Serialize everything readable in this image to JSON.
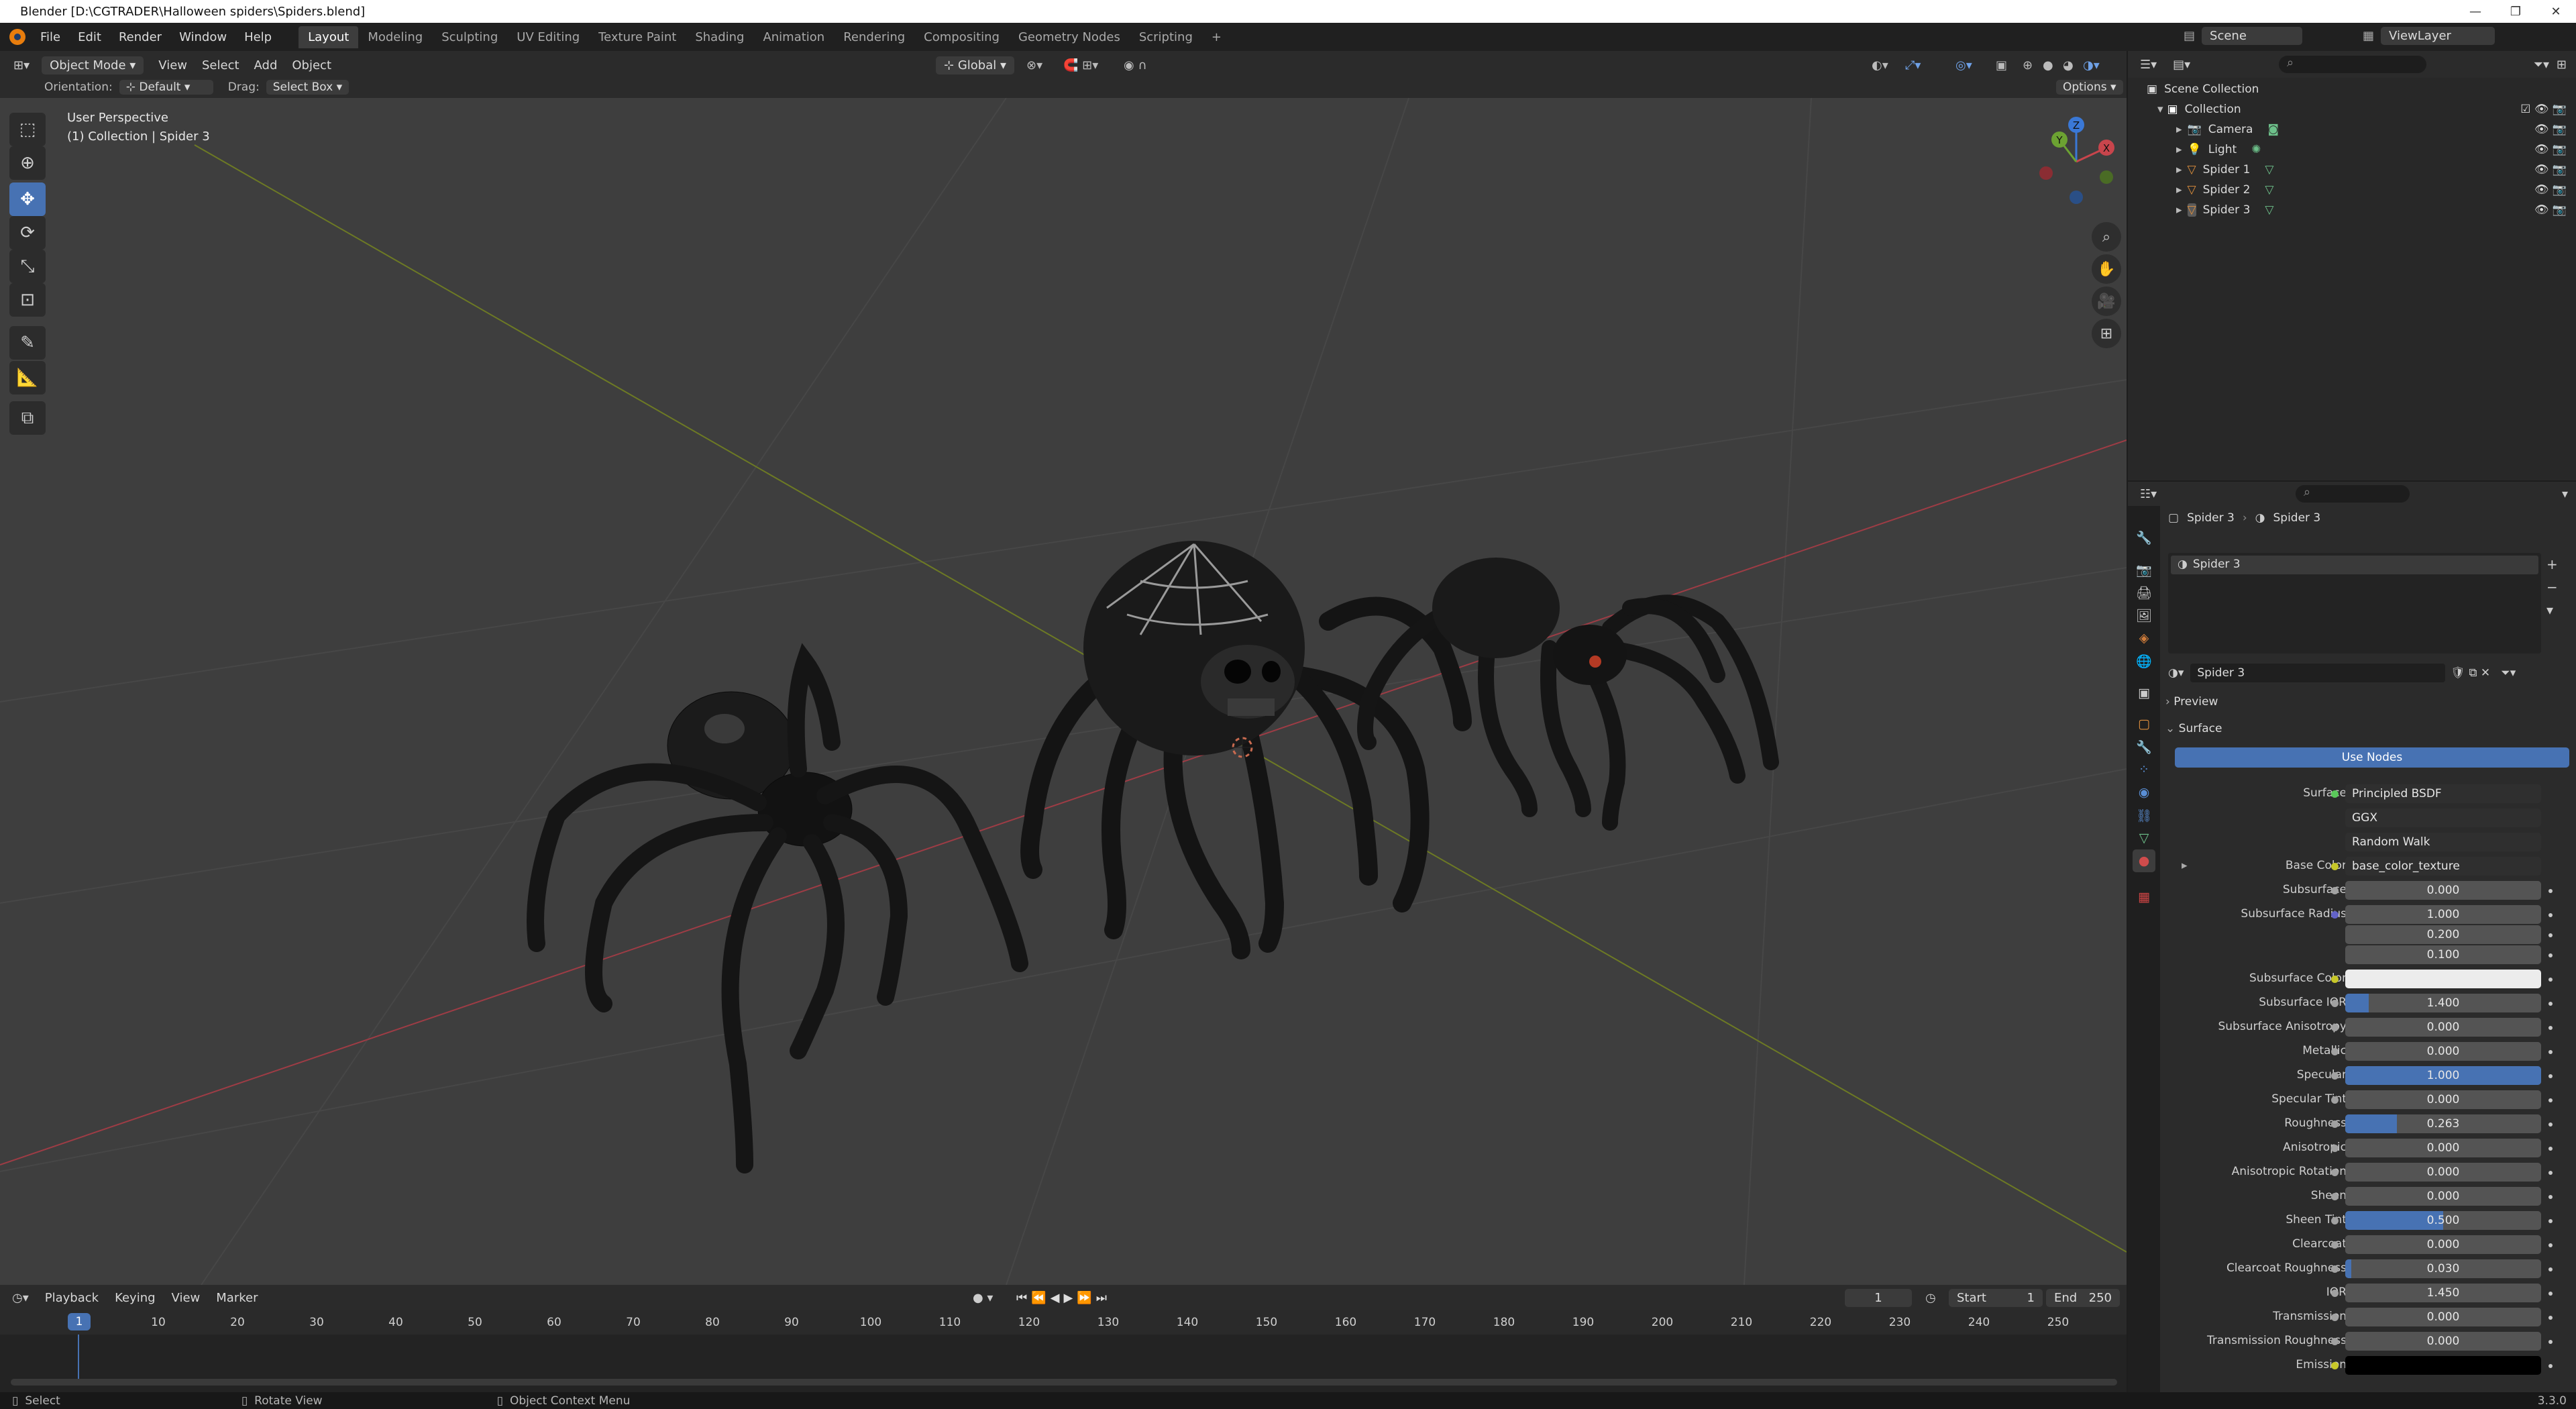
{
  "window": {
    "title": "Blender [D:\\CGTRADER\\Halloween spiders\\Spiders.blend]",
    "min": "—",
    "max": "❐",
    "close": "✕"
  },
  "menus": [
    "File",
    "Edit",
    "Render",
    "Window",
    "Help"
  ],
  "workspaces": [
    "Layout",
    "Modeling",
    "Sculpting",
    "UV Editing",
    "Texture Paint",
    "Shading",
    "Animation",
    "Rendering",
    "Compositing",
    "Geometry Nodes",
    "Scripting",
    "+"
  ],
  "scene": {
    "name": "Scene",
    "view_layer": "ViewLayer"
  },
  "viewport": {
    "mode": "Object Mode",
    "header_menus": [
      "View",
      "Select",
      "Add",
      "Object"
    ],
    "transform_orientation": "Global",
    "orientation_label": "Orientation:",
    "orientation_value": "Default",
    "drag_label": "Drag:",
    "drag_value": "Select Box",
    "options": "Options",
    "overlay_title": "User Perspective",
    "overlay_sub": "(1) Collection | Spider 3",
    "gizmo": {
      "x": "X",
      "y": "Y",
      "z": "Z"
    }
  },
  "outliner": {
    "scene_collection": "Scene Collection",
    "collection": "Collection",
    "items": [
      {
        "name": "Camera"
      },
      {
        "name": "Light"
      },
      {
        "name": "Spider 1"
      },
      {
        "name": "Spider 2"
      },
      {
        "name": "Spider 3"
      }
    ]
  },
  "properties": {
    "breadcrumb_object": "Spider 3",
    "breadcrumb_material": "Spider 3",
    "slot": "Spider 3",
    "material": "Spider 3",
    "preview": "Preview",
    "surface_panel": "Surface",
    "use_nodes": "Use Nodes",
    "surface_label": "Surface",
    "surface_value": "Principled BSDF",
    "distribution": "GGX",
    "subsurface_method": "Random Walk",
    "base_color_label": "Base Color",
    "base_color_value": "base_color_texture",
    "params": [
      {
        "label": "Subsurface",
        "value": "0.000",
        "fraction": 0
      },
      {
        "label": "Subsurface Radius",
        "value": "1.000",
        "fraction": 0
      },
      {
        "label": "",
        "value": "0.200",
        "fraction": 0
      },
      {
        "label": "",
        "value": "0.100",
        "fraction": 0
      },
      {
        "label": "Subsurface Color",
        "value": "",
        "fraction": 0
      },
      {
        "label": "Subsurface IOR",
        "value": "1.400",
        "fraction": 0.12
      },
      {
        "label": "Subsurface Anisotropy",
        "value": "0.000",
        "fraction": 0
      },
      {
        "label": "Metallic",
        "value": "0.000",
        "fraction": 0
      },
      {
        "label": "Specular",
        "value": "1.000",
        "fraction": 1
      },
      {
        "label": "Specular Tint",
        "value": "0.000",
        "fraction": 0
      },
      {
        "label": "Roughness",
        "value": "0.263",
        "fraction": 0.263
      },
      {
        "label": "Anisotropic",
        "value": "0.000",
        "fraction": 0
      },
      {
        "label": "Anisotropic Rotation",
        "value": "0.000",
        "fraction": 0
      },
      {
        "label": "Sheen",
        "value": "0.000",
        "fraction": 0
      },
      {
        "label": "Sheen Tint",
        "value": "0.500",
        "fraction": 0.5
      },
      {
        "label": "Clearcoat",
        "value": "0.000",
        "fraction": 0
      },
      {
        "label": "Clearcoat Roughness",
        "value": "0.030",
        "fraction": 0.03
      },
      {
        "label": "IOR",
        "value": "1.450",
        "fraction": 0
      },
      {
        "label": "Transmission",
        "value": "0.000",
        "fraction": 0
      },
      {
        "label": "Transmission Roughness",
        "value": "0.000",
        "fraction": 0
      },
      {
        "label": "Emission",
        "value": "",
        "fraction": 0
      }
    ]
  },
  "timeline": {
    "menus": [
      "Playback",
      "Keying",
      "View",
      "Marker"
    ],
    "current_frame": "1",
    "start_label": "Start",
    "start": "1",
    "end_label": "End",
    "end": "250",
    "ticks": [
      "10",
      "20",
      "30",
      "40",
      "50",
      "60",
      "70",
      "80",
      "90",
      "100",
      "110",
      "120",
      "130",
      "140",
      "150",
      "160",
      "170",
      "180",
      "190",
      "200",
      "210",
      "220",
      "230",
      "240",
      "250"
    ]
  },
  "status": {
    "select": "Select",
    "rotate": "Rotate View",
    "context": "Object Context Menu",
    "version": "3.3.0"
  },
  "colors": {
    "accent": "#4772b3",
    "header": "#2b2b2b",
    "viewport": "#3e3e3e",
    "x_axis": "#b0454a",
    "y_axis": "#7a8c2a"
  }
}
